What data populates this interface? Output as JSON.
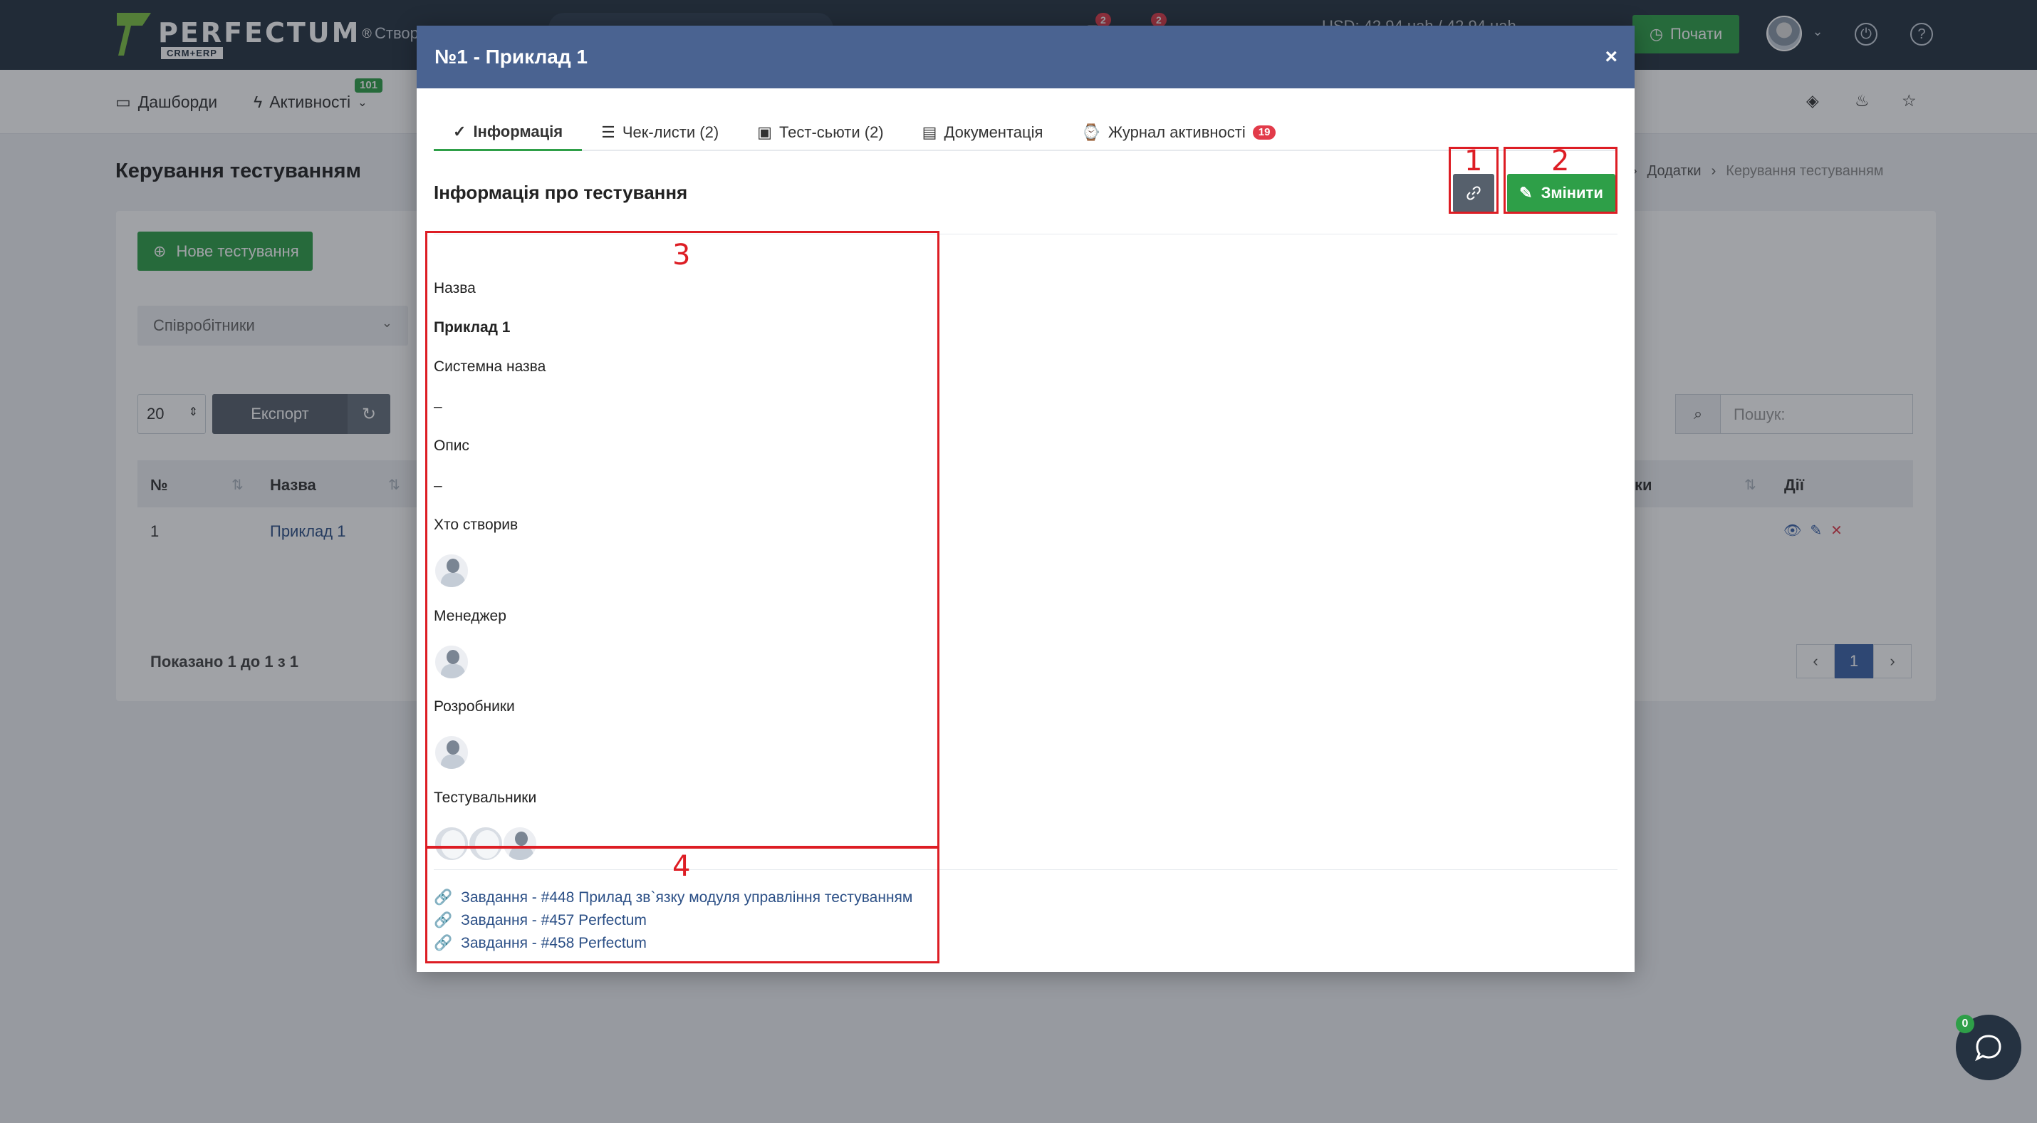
{
  "topbar": {
    "logo_name": "PERFECTUM",
    "logo_sub": "CRM+ERP",
    "logo_reg": "®",
    "create_label": "Створ",
    "currency": "USD: 42.94 uah / 42.94 uah",
    "notif_badge_1": "2",
    "notif_badge_2": "2",
    "start_label": "Почати"
  },
  "subnav": {
    "dashboards": "Дашборди",
    "activities": "Активності",
    "activities_badge": "101"
  },
  "page": {
    "title": "Керування тестуванням",
    "breadcrumb": [
      "Додатки",
      "Керування тестуванням"
    ],
    "new_button": "Нове тестування",
    "filter_placeholder": "Співробітники",
    "per_page": "20",
    "export_label": "Експорт",
    "search_placeholder": "Пошук:",
    "columns": [
      "№",
      "Назва",
      "ки",
      "Дії"
    ],
    "rows": [
      {
        "num": "1",
        "name": "Приклад 1"
      }
    ],
    "shown_text": "Показано 1 до 1 з 1",
    "pages": [
      "1"
    ],
    "chat_badge": "0"
  },
  "modal": {
    "title": "№1 - Приклад 1",
    "tabs": [
      {
        "label": "Інформація",
        "icon": "check-circle-icon"
      },
      {
        "label": "Чек-листи (2)",
        "icon": "list-icon"
      },
      {
        "label": "Тест-сьюти (2)",
        "icon": "briefcase-icon"
      },
      {
        "label": "Документація",
        "icon": "document-icon"
      },
      {
        "label": "Журнал активності",
        "icon": "watch-icon",
        "badge": "19"
      }
    ],
    "section_title": "Інформація про тестування",
    "edit_label": "Змінити",
    "fields": {
      "name_label": "Назва",
      "name_value": "Приклад 1",
      "system_name_label": "Системна назва",
      "system_name_value": "–",
      "description_label": "Опис",
      "description_value": "–",
      "creator_label": "Хто створив",
      "manager_label": "Менеджер",
      "developers_label": "Розробники",
      "testers_label": "Тестувальники"
    },
    "task_links": [
      "Завдання - #448 Прилад зв`язку модуля управління тестуванням",
      "Завдання - #457 Perfectum",
      "Завдання - #458 Perfectum"
    ]
  },
  "annotations": [
    "1",
    "2",
    "3",
    "4"
  ],
  "colors": {
    "header_dark": "#253241",
    "modal_header": "#4a6391",
    "accent_green": "#2e9f48",
    "annotation_red": "#dd1d24",
    "link_blue": "#2b4f86"
  }
}
